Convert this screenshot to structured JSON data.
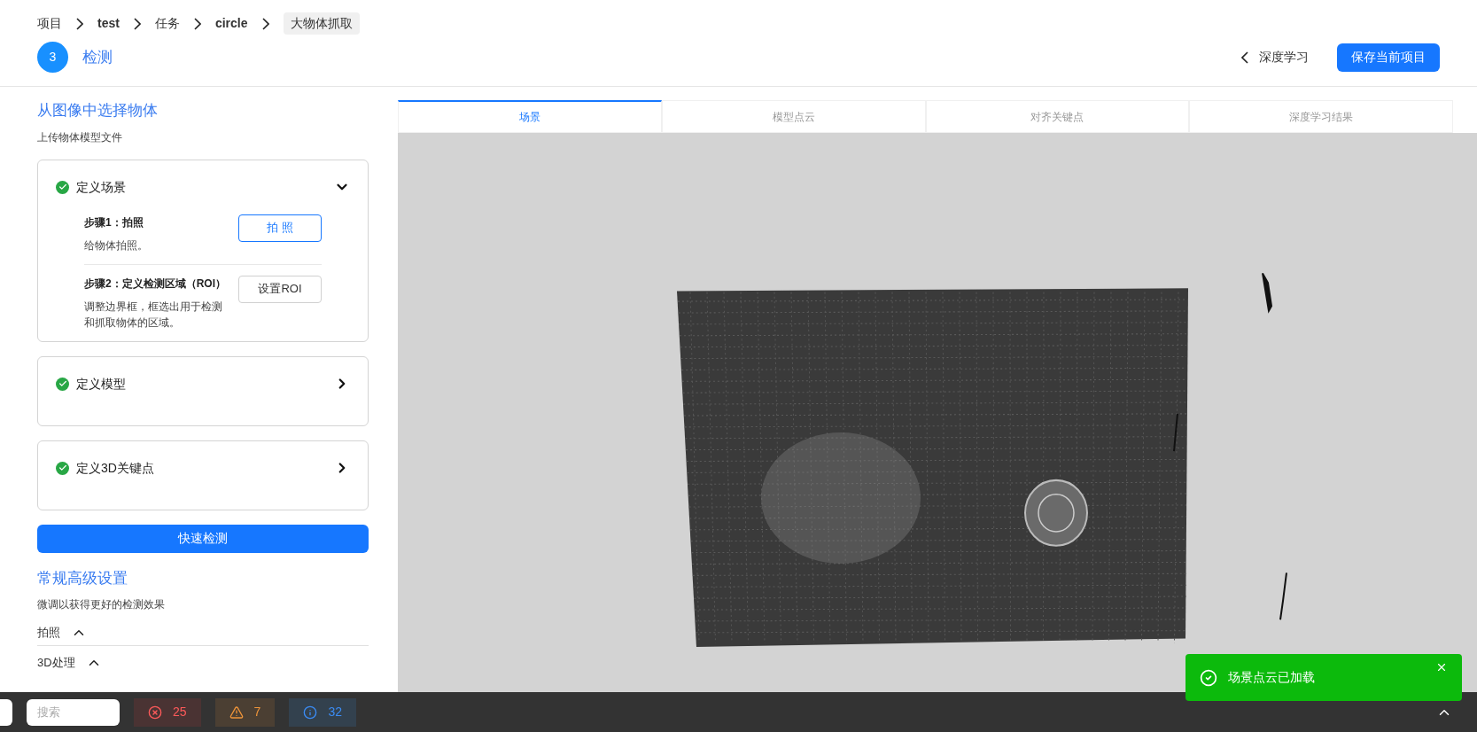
{
  "breadcrumb": [
    {
      "label": "项目",
      "kind": "link"
    },
    {
      "label": "test",
      "kind": "link"
    },
    {
      "label": "任务",
      "kind": "link"
    },
    {
      "label": "circle",
      "kind": "link"
    },
    {
      "label": "大物体抓取",
      "kind": "tag"
    }
  ],
  "step": {
    "number": "3",
    "title": "检测"
  },
  "back_link": "深度学习",
  "save_button": "保存当前项目",
  "panel": {
    "title": "从图像中选择物体",
    "subtitle": "上传物体模型文件",
    "sections": [
      {
        "title": "定义场景",
        "done": true,
        "expanded": true,
        "steps": [
          {
            "title": "步骤1：拍照",
            "description": "给物体拍照。",
            "button": "拍 照",
            "kind": "primary"
          },
          {
            "title": "步骤2：定义检测区域（ROI）",
            "description": "调整边界框，框选出用于检测和抓取物体的区域。",
            "button": "设置ROI",
            "kind": "default"
          }
        ]
      },
      {
        "title": "定义模型",
        "done": true,
        "expanded": false
      },
      {
        "title": "定义3D关键点",
        "done": true,
        "expanded": false
      }
    ],
    "quick_button": "快速检测",
    "advanced_title": "常规高级设置",
    "advanced_subtitle": "微调以获得更好的检测效果",
    "groups": [
      {
        "label": "拍照",
        "expanded": true
      },
      {
        "label": "3D处理",
        "expanded": true
      }
    ]
  },
  "viewer_tabs": [
    {
      "label": "场景",
      "selected": true
    },
    {
      "label": "模型点云",
      "selected": false
    },
    {
      "label": "对齐关键点",
      "selected": false
    },
    {
      "label": "深度学习结果",
      "selected": false
    }
  ],
  "bottom_bar": {
    "search_placeholder": "搜索",
    "counters": [
      {
        "kind": "error",
        "count": "25"
      },
      {
        "kind": "warning",
        "count": "7"
      },
      {
        "kind": "info",
        "count": "32"
      }
    ]
  },
  "toast": {
    "message": "场景点云已加载"
  }
}
